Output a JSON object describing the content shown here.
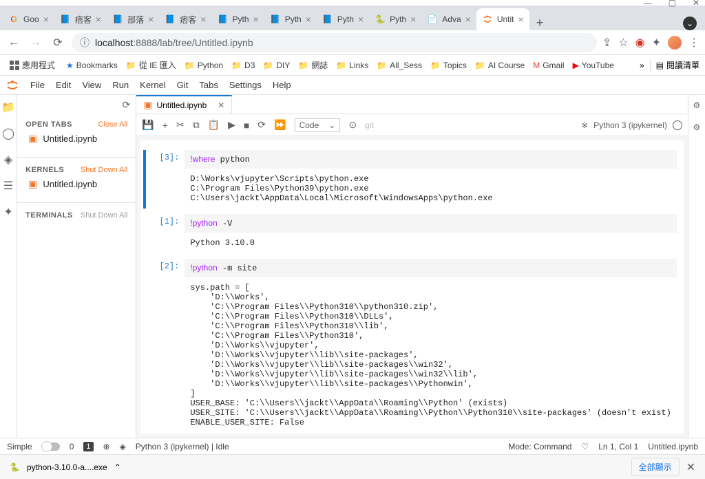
{
  "window": {
    "minimize": "—",
    "maximize": "▢",
    "close": "✕"
  },
  "browser": {
    "tabs": [
      {
        "title": "Goo",
        "favicon": "G"
      },
      {
        "title": "痞客",
        "favicon": "blue"
      },
      {
        "title": "部落",
        "favicon": "blue"
      },
      {
        "title": "痞客",
        "favicon": "blue"
      },
      {
        "title": "Pyth",
        "favicon": "blue"
      },
      {
        "title": "Pyth",
        "favicon": "blue"
      },
      {
        "title": "Pyth",
        "favicon": "blue"
      },
      {
        "title": "Pyth",
        "favicon": "py"
      },
      {
        "title": "Adva",
        "favicon": "doc"
      },
      {
        "title": "Untit",
        "favicon": "jup",
        "active": true
      }
    ],
    "url": {
      "info_icon": "ⓘ",
      "host": "localhost",
      "port": ":8888",
      "path": "/lab/tree/Untitled.ipynb"
    }
  },
  "bookmarks": {
    "apps": "應用程式",
    "items": [
      "Bookmarks",
      "從 IE 匯入",
      "Python",
      "D3",
      "DIY",
      "網誌",
      "Links",
      "All_Sess",
      "Topics",
      "AI Course",
      "Gmail",
      "YouTube"
    ],
    "more": "»",
    "reading": "閱讀清單"
  },
  "menu": [
    "File",
    "Edit",
    "View",
    "Run",
    "Kernel",
    "Git",
    "Tabs",
    "Settings",
    "Help"
  ],
  "sidebar": {
    "open_tabs": {
      "header": "OPEN TABS",
      "action": "Close All",
      "items": [
        "Untitled.ipynb"
      ]
    },
    "kernels": {
      "header": "KERNELS",
      "action": "Shut Down All",
      "items": [
        "Untitled.ipynb"
      ]
    },
    "terminals": {
      "header": "TERMINALS",
      "action": "Shut Down All"
    }
  },
  "tab": {
    "name": "Untitled.ipynb"
  },
  "toolbar": {
    "cell_type": "Code",
    "git": "git",
    "kernel": "Python 3 (ipykernel)"
  },
  "cells": [
    {
      "prompt": "[3]:",
      "selected": true,
      "input_prefix": "!where",
      "input_rest": " python",
      "output": "D:\\Works\\vjupyter\\Scripts\\python.exe\nC:\\Program Files\\Python39\\python.exe\nC:\\Users\\jackt\\AppData\\Local\\Microsoft\\WindowsApps\\python.exe"
    },
    {
      "prompt": "[1]:",
      "input_prefix": "!python",
      "input_rest": " -V",
      "output": "Python 3.10.0"
    },
    {
      "prompt": "[2]:",
      "input_prefix": "!python",
      "input_rest": " -m site",
      "output": "sys.path = [\n    'D:\\\\Works',\n    'C:\\\\Program Files\\\\Python310\\\\python310.zip',\n    'C:\\\\Program Files\\\\Python310\\\\DLLs',\n    'C:\\\\Program Files\\\\Python310\\\\lib',\n    'C:\\\\Program Files\\\\Python310',\n    'D:\\\\Works\\\\vjupyter',\n    'D:\\\\Works\\\\vjupyter\\\\lib\\\\site-packages',\n    'D:\\\\Works\\\\vjupyter\\\\lib\\\\site-packages\\\\win32',\n    'D:\\\\Works\\\\vjupyter\\\\lib\\\\site-packages\\\\win32\\\\lib',\n    'D:\\\\Works\\\\vjupyter\\\\lib\\\\site-packages\\\\Pythonwin',\n]\nUSER_BASE: 'C:\\\\Users\\\\jackt\\\\AppData\\\\Roaming\\\\Python' (exists)\nUSER_SITE: 'C:\\\\Users\\\\jackt\\\\AppData\\\\Roaming\\\\Python\\\\Python310\\\\site-packages' (doesn't exist)\nENABLE_USER_SITE: False"
    }
  ],
  "status": {
    "simple": "Simple",
    "tabs_count": "0",
    "sessions": "1",
    "kernel": "Python 3 (ipykernel) | Idle",
    "mode": "Mode: Command",
    "pos": "Ln 1, Col 1",
    "file": "Untitled.ipynb"
  },
  "download": {
    "file": "python-3.10.0-a....exe",
    "show_all": "全部顯示"
  }
}
